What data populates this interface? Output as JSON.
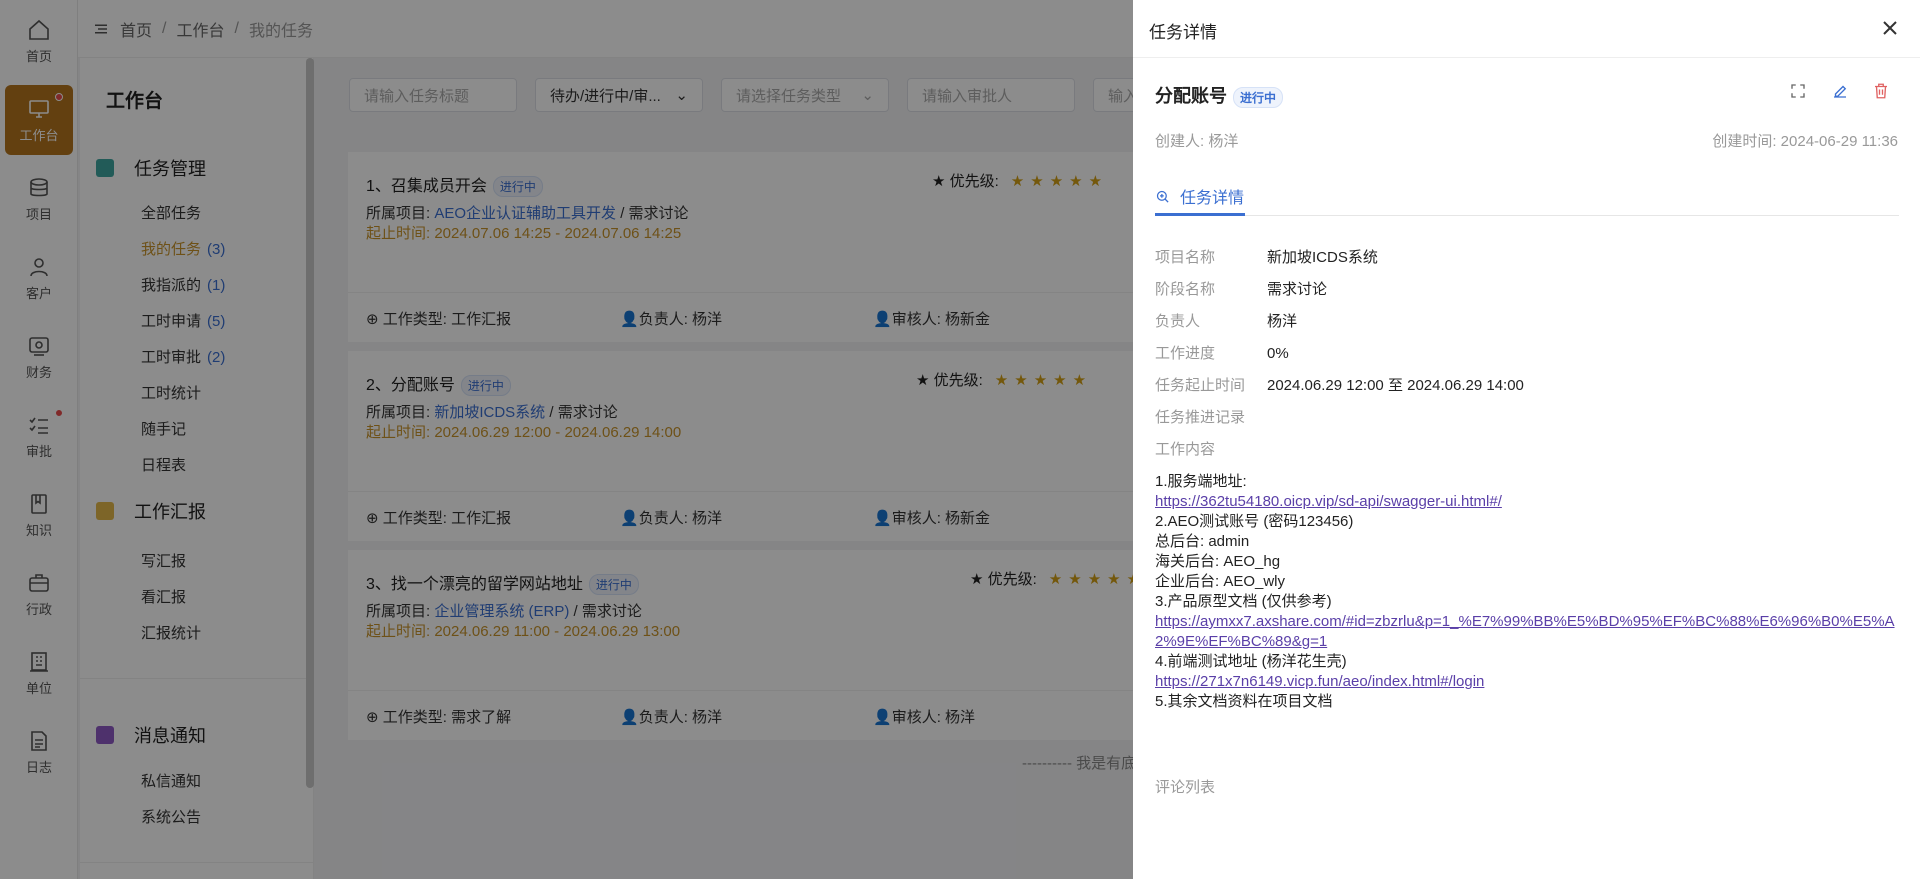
{
  "rail": [
    {
      "label": "首页",
      "icon": "home-icon"
    },
    {
      "label": "工作台",
      "icon": "monitor-icon",
      "active": true,
      "dot": true
    },
    {
      "label": "项目",
      "icon": "database-icon"
    },
    {
      "label": "客户",
      "icon": "user-icon"
    },
    {
      "label": "财务",
      "icon": "finance-icon"
    },
    {
      "label": "审批",
      "icon": "checklist-icon",
      "dot": true
    },
    {
      "label": "知识",
      "icon": "book-icon"
    },
    {
      "label": "行政",
      "icon": "briefcase-icon"
    },
    {
      "label": "单位",
      "icon": "building-icon"
    },
    {
      "label": "日志",
      "icon": "log-icon"
    }
  ],
  "breadcrumb": {
    "home": "首页",
    "workbench": "工作台",
    "current": "我的任务"
  },
  "sidebar": {
    "title": "工作台",
    "task_mgmt": {
      "label": "任务管理",
      "items": [
        {
          "label": "全部任务",
          "count": ""
        },
        {
          "label": "我的任务",
          "count": "(3)"
        },
        {
          "label": "我指派的",
          "count": "(1)"
        },
        {
          "label": "工时申请",
          "count": "(5)"
        },
        {
          "label": "工时审批",
          "count": "(2)"
        },
        {
          "label": "工时统计",
          "count": ""
        },
        {
          "label": "随手记",
          "count": ""
        },
        {
          "label": "日程表",
          "count": ""
        }
      ]
    },
    "report": {
      "label": "工作汇报",
      "items": [
        "写汇报",
        "看汇报",
        "汇报统计"
      ]
    },
    "msg": {
      "label": "消息通知",
      "items": [
        "私信通知",
        "系统公告"
      ]
    }
  },
  "filters": {
    "title_ph": "请输入任务标题",
    "status": "待办/进行中/审...",
    "type_ph": "请选择任务类型",
    "approver_ph": "请输入审批人",
    "more_ph": "输入"
  },
  "tasks": [
    {
      "title": "1、召集成员开会",
      "status": "进行中",
      "priority_label": "优先级:",
      "stars": "★★★★★",
      "project_label": "所属项目:",
      "project": "AEO企业认证辅助工具开发",
      "stage": " / 需求讨论",
      "time": "起止时间:  2024.07.06 14:25 - 2024.07.06 14:25",
      "type": "工作类型: 工作汇报",
      "owner": "负责人: 杨洋",
      "reviewer": "审核人: 杨新金"
    },
    {
      "title": "2、分配账号",
      "status": "进行中",
      "priority_label": "优先级:",
      "stars": "★★★★★",
      "project_label": "所属项目:",
      "project": "新加坡ICDS系统",
      "stage": " / 需求讨论",
      "time": "起止时间:  2024.06.29 12:00 - 2024.06.29 14:00",
      "type": "工作类型: 工作汇报",
      "owner": "负责人: 杨洋",
      "reviewer": "审核人: 杨新金"
    },
    {
      "title": "3、找一个漂亮的留学网站地址",
      "status": "进行中",
      "priority_label": "优先级:",
      "stars": "★★★★★",
      "project_label": "所属项目:",
      "project": "企业管理系统 (ERP)",
      "stage": "  / 需求讨论",
      "time": "起止时间:  2024.06.29 11:00 - 2024.06.29 13:00",
      "type": "工作类型: 需求了解",
      "owner": "负责人: 杨洋",
      "reviewer": "审核人: 杨洋"
    }
  ],
  "end_note": "---------- 我是有底",
  "drawer": {
    "header": "任务详情",
    "task_title": "分配账号",
    "status": "进行中",
    "creator": "创建人: 杨洋",
    "created": "创建时间: 2024-06-29 11:36",
    "tab": "任务详情",
    "fields": [
      {
        "k": "项目名称",
        "v": "新加坡ICDS系统"
      },
      {
        "k": "阶段名称",
        "v": "需求讨论"
      },
      {
        "k": "负责人",
        "v": "杨洋"
      },
      {
        "k": "工作进度",
        "v": "0%"
      },
      {
        "k": "任务起止时间",
        "v": "2024.06.29 12:00 至 2024.06.29 14:00"
      },
      {
        "k": "任务推进记录",
        "v": ""
      },
      {
        "k": "工作内容",
        "v": ""
      }
    ],
    "content": {
      "l1": "1.服务端地址:",
      "link1": "https://362tu54180.oicp.vip/sd-api/swagger-ui.html#/",
      "l2": "2.AEO测试账号 (密码123456)",
      "l3": "总后台: admin",
      "l4": "海关后台: AEO_hg",
      "l5": "企业后台: AEO_wly",
      "l6": "3.产品原型文档 (仅供参考)",
      "link2": "https://aymxx7.axshare.com/#id=zbzrlu&p=1_%E7%99%BB%E5%BD%95%EF%BC%88%E6%96%B0%E5%A2%9E%EF%BC%89&g=1",
      "l7": "4.前端测试地址 (杨洋花生壳)",
      "link3": "https://271x7n6149.vicp.fun/aeo/index.html#/login",
      "l8": "5.其余文档资料在项目文档"
    },
    "comments": "评论列表"
  },
  "colors": {
    "accent": "#3b6fd1",
    "gold": "#c8942b",
    "rail_active": "#b5761e"
  }
}
